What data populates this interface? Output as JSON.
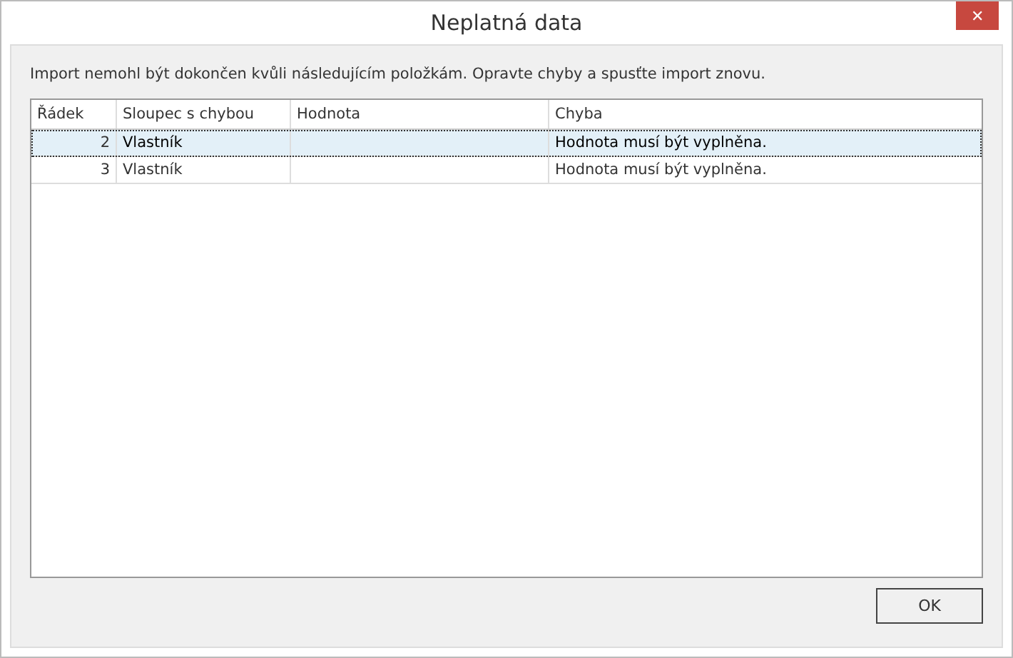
{
  "window": {
    "title": "Neplatná data",
    "close": "✕"
  },
  "message": "Import nemohl být dokončen kvůli následujícím položkám. Opravte chyby a spusťte import znovu.",
  "table": {
    "columns": [
      "Řádek",
      "Sloupec s chybou",
      "Hodnota",
      "Chyba"
    ],
    "rows": [
      {
        "cells": [
          "2",
          "Vlastník",
          "",
          "Hodnota musí být vyplněna."
        ],
        "selected": true
      },
      {
        "cells": [
          "3",
          "Vlastník",
          "",
          "Hodnota musí být vyplněna."
        ],
        "selected": false
      }
    ]
  },
  "buttons": [
    "OK"
  ]
}
